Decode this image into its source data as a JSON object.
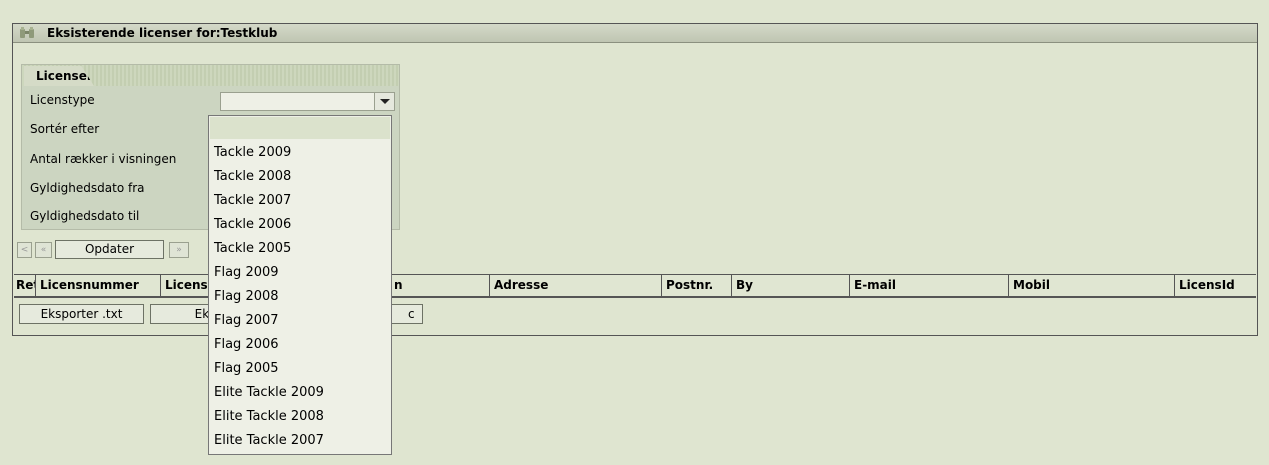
{
  "window": {
    "title": "Eksisterende licenser for:Testklub",
    "icon": "binoculars-icon"
  },
  "filters": {
    "tab_label": "Licenser",
    "labels": [
      "Licenstype",
      "Sortér efter",
      "Antal rækker i visningen",
      "Gyldighedsdato fra",
      "Gyldighedsdato til"
    ],
    "licenstype_value": ""
  },
  "nav": {
    "first": "<",
    "prev": "«",
    "update": "Opdater",
    "next": "»"
  },
  "table": {
    "columns": [
      "Ret",
      "Licensnummer",
      "Licens",
      "n",
      "Adresse",
      "Postnr.",
      "By",
      "E-mail",
      "Mobil",
      "LicensId"
    ]
  },
  "export": {
    "txt": "Eksporter .txt",
    "second": "Ekspo",
    "third": "c"
  },
  "dropdown": {
    "options": [
      "",
      "Tackle 2009",
      "Tackle 2008",
      "Tackle 2007",
      "Tackle 2006",
      "Tackle 2005",
      "Flag 2009",
      "Flag 2008",
      "Flag 2007",
      "Flag 2006",
      "Flag 2005",
      "Elite Tackle 2009",
      "Elite Tackle 2008",
      "Elite Tackle 2007"
    ]
  }
}
